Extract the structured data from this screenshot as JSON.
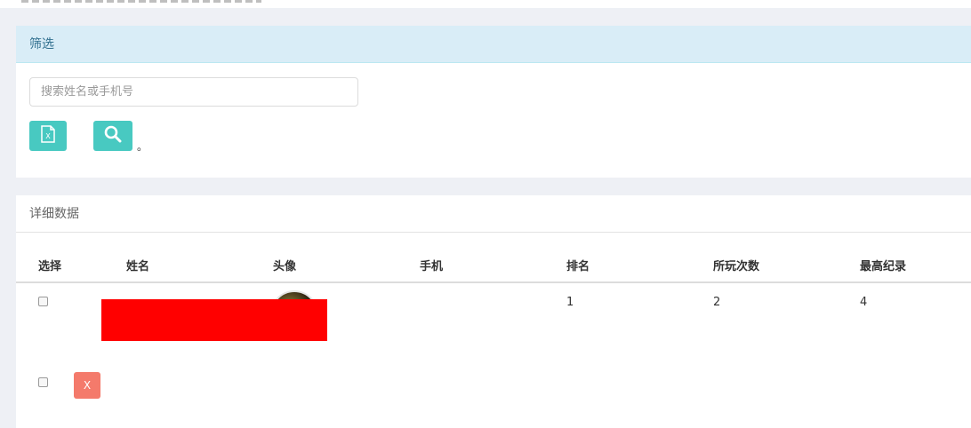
{
  "filter": {
    "title": "筛选",
    "search_placeholder": "搜索姓名或手机号",
    "export_icon": "excel-icon",
    "search_icon": "search-icon",
    "trailing_mark": "。"
  },
  "detail": {
    "title": "详细数据",
    "columns": [
      "选择",
      "姓名",
      "头像",
      "手机",
      "排名",
      "所玩次数",
      "最高纪录"
    ],
    "rows": [
      {
        "name": "",
        "phone": "",
        "rank": "1",
        "plays": "2",
        "record": "4"
      }
    ],
    "delete_label": "X"
  },
  "colors": {
    "page_bg": "#eef0f5",
    "filter_header_bg": "#d9edf7",
    "filter_header_text": "#31708f",
    "teal": "#48c9c1",
    "danger": "#f47a6b",
    "redaction": "#ff0000"
  }
}
